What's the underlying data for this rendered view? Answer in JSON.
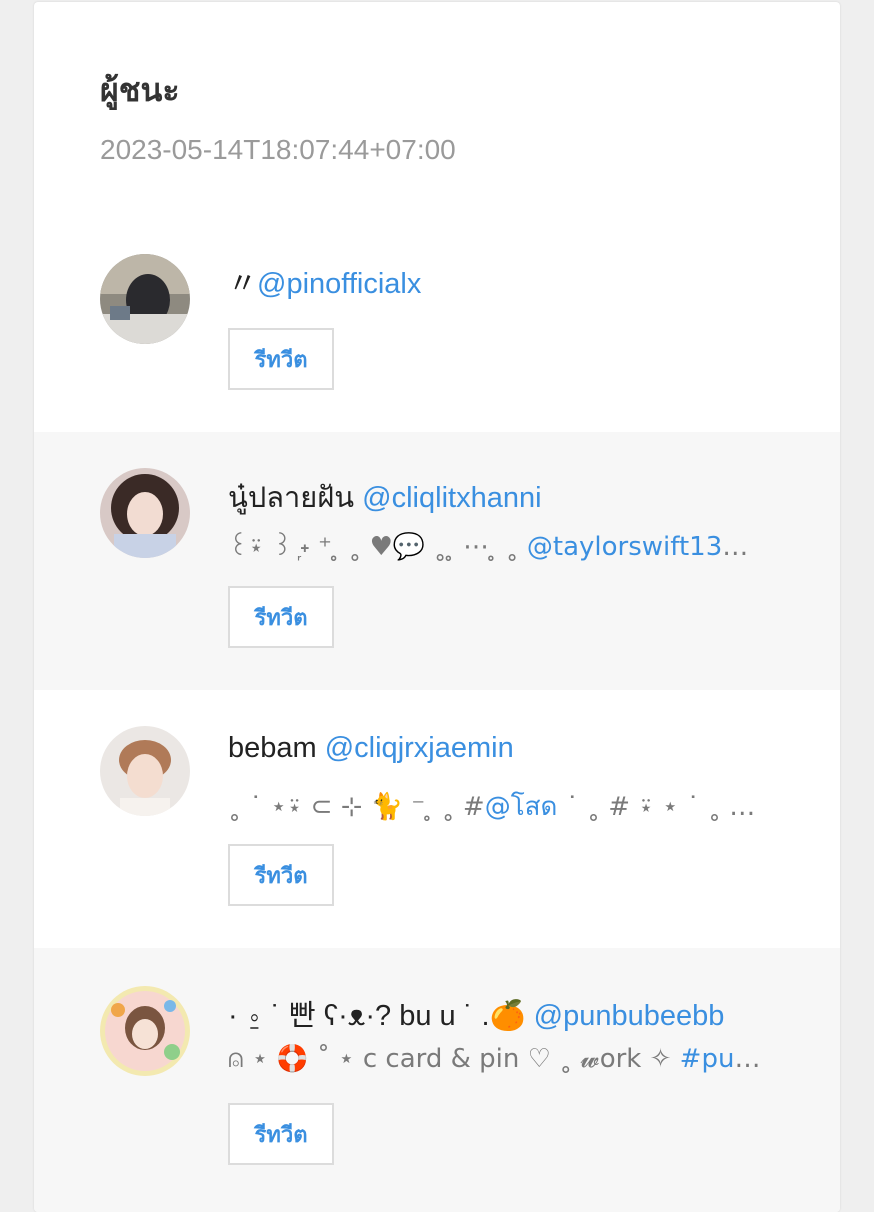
{
  "page": {
    "title": "ผู้ชนะ",
    "timestamp": "2023-05-14T18:07:44+07:00"
  },
  "entries": [
    {
      "display_name": "〃",
      "handle": "@pinofficialx",
      "bio_text": "",
      "bio_link": "",
      "retweet_label": "รีทวีต"
    },
    {
      "display_name": "นู๋ปลายฝัน",
      "handle": "@cliqlitxhanni",
      "bio_text": "꒰⍣ ꒱ ᷊˖ ⁺ ̥ ˳ ♥💬 ˳ ̥ ⋯ ̥ ˳ ",
      "bio_link": "@taylorswift13💔 ˳ ̥...",
      "retweet_label": "รีทวีต"
    },
    {
      "display_name": "bebam",
      "handle": "@cliqjrxjaemin",
      "bio_text": "˳ ˙ ⋆⍣ ⊂ ⊹ 🐈 ⁻ ̥ ˳ #",
      "bio_link": "@โสด",
      "bio_tail": " ˙ ˳ # ⍣ ⋆ ˙ ˳ ★ 👾 ̥ ˳ ⊂ ⊹...",
      "retweet_label": "รีทวีต"
    },
    {
      "display_name": "· ⍛ ˙ 빤 ʕ·ᴥ·? bu u ˙ .🍊",
      "handle": "@punbubeebb",
      "bio_text": "⍝ ⋆ 🛟 ˚ ⋆ c card & pin ♡ ˳ 𝔀ork ✧ ",
      "bio_link": "#pun...",
      "retweet_label": "รีทวีต"
    }
  ],
  "colors": {
    "accent": "#3a8fe0",
    "alt_row": "#f7f7f7",
    "timestamp": "#9a9a9a"
  }
}
